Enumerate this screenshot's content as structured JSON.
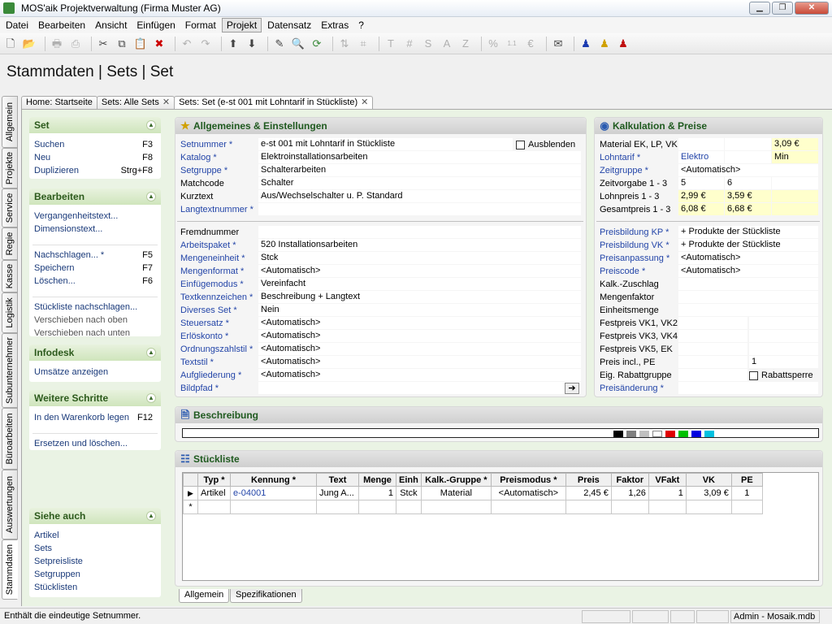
{
  "window": {
    "title": "MOS'aik Projektverwaltung (Firma Muster AG)",
    "accent": "#2c5a1c"
  },
  "menu": [
    "Datei",
    "Bearbeiten",
    "Ansicht",
    "Einfügen",
    "Format",
    "Projekt",
    "Datensatz",
    "Extras",
    "?"
  ],
  "menu_active": "Projekt",
  "page_title": "Stammdaten | Sets | Set",
  "vtabs": [
    "Allgemein",
    "Projekte",
    "Service",
    "Regie",
    "Kasse",
    "Logistik",
    "Subunternehmer",
    "Büroarbeiten",
    "Auswertungen",
    "Stammdaten"
  ],
  "doc_tabs": [
    {
      "label": "Home: Startseite",
      "closable": false
    },
    {
      "label": "Sets: Alle Sets",
      "closable": true
    },
    {
      "label": "Sets: Set (e-st 001 mit Lohntarif in Stückliste)",
      "closable": true
    }
  ],
  "close_glyph": "✕",
  "sidebar": {
    "set": {
      "title": "Set",
      "items": [
        {
          "label": "Suchen",
          "key": "F3"
        },
        {
          "label": "Neu",
          "key": "F8"
        },
        {
          "label": "Duplizieren",
          "key": "Strg+F8"
        }
      ]
    },
    "bearbeiten": {
      "title": "Bearbeiten",
      "items": [
        {
          "label": "Vergangenheitstext...",
          "key": ""
        },
        {
          "label": "Dimensionstext...",
          "key": ""
        },
        {
          "label": "Nachschlagen... *",
          "key": "F5"
        },
        {
          "label": "Speichern",
          "key": "F7"
        },
        {
          "label": "Löschen...",
          "key": "F6"
        },
        {
          "label": "Stückliste nachschlagen...",
          "key": ""
        },
        {
          "label": "Verschieben nach oben",
          "key": ""
        },
        {
          "label": "Verschieben nach unten",
          "key": ""
        }
      ]
    },
    "infodesk": {
      "title": "Infodesk",
      "items": [
        {
          "label": "Umsätze anzeigen",
          "key": ""
        }
      ]
    },
    "weitere": {
      "title": "Weitere Schritte",
      "items": [
        {
          "label": "In den Warenkorb legen",
          "key": "F12"
        },
        {
          "label": "Ersetzen und löschen...",
          "key": ""
        }
      ]
    },
    "siehe": {
      "title": "Siehe auch",
      "items": [
        "Artikel",
        "Sets",
        "Setpreisliste",
        "Setgruppen",
        "Stücklisten"
      ]
    }
  },
  "allgemeines": {
    "title": "Allgemeines & Einstellungen",
    "ausblenden": "Ausblenden",
    "fields1": [
      {
        "label": "Setnummer *",
        "value": "e-st 001 mit Lohntarif in Stückliste",
        "req": true
      },
      {
        "label": "Katalog *",
        "value": "Elektroinstallationsarbeiten",
        "req": true
      },
      {
        "label": "Setgruppe *",
        "value": "Schalterarbeiten",
        "req": true
      },
      {
        "label": "Matchcode",
        "value": "Schalter",
        "req": false
      },
      {
        "label": "Kurztext",
        "value": "Aus/Wechselschalter u. P. Standard",
        "req": false
      },
      {
        "label": "Langtextnummer *",
        "value": "",
        "req": true
      }
    ],
    "fields2": [
      {
        "label": "Fremdnummer",
        "value": "",
        "req": false
      },
      {
        "label": "Arbeitspaket *",
        "value": "520 Installationsarbeiten",
        "req": true
      },
      {
        "label": "Mengeneinheit *",
        "value": "Stck",
        "req": true
      },
      {
        "label": "Mengenformat *",
        "value": "<Automatisch>",
        "req": true
      },
      {
        "label": "Einfügemodus *",
        "value": "Vereinfacht",
        "req": true
      },
      {
        "label": "Textkennzeichen *",
        "value": "Beschreibung + Langtext",
        "req": true
      },
      {
        "label": "Diverses Set *",
        "value": "Nein",
        "req": true
      },
      {
        "label": "Steuersatz *",
        "value": "<Automatisch>",
        "req": true
      },
      {
        "label": "Erlöskonto *",
        "value": "<Automatisch>",
        "req": true
      },
      {
        "label": "Ordnungszahlstil *",
        "value": "<Automatisch>",
        "req": true
      },
      {
        "label": "Textstil *",
        "value": "<Automatisch>",
        "req": true
      },
      {
        "label": "Aufgliederung *",
        "value": "<Automatisch>",
        "req": true
      },
      {
        "label": "Bildpfad *",
        "value": "",
        "req": true
      }
    ]
  },
  "kalkulation": {
    "title": "Kalkulation & Preise",
    "rows1": [
      {
        "label": "Material EK, LP, VK",
        "req": false,
        "v": [
          "",
          "",
          "3,09 €"
        ],
        "y": [
          false,
          false,
          true
        ]
      },
      {
        "label": "Lohntarif *",
        "req": true,
        "v": [
          "Elektro",
          "",
          "Min"
        ],
        "y": [
          false,
          false,
          true
        ],
        "blue": [
          true,
          false,
          false
        ]
      },
      {
        "label": "Zeitgruppe *",
        "req": true,
        "v": [
          "<Automatisch>"
        ],
        "y": [
          false
        ]
      },
      {
        "label": "Zeitvorgabe 1 - 3",
        "req": false,
        "v": [
          "5",
          "6",
          ""
        ],
        "y": [
          false,
          false,
          false
        ]
      },
      {
        "label": "Lohnpreis 1 - 3",
        "req": false,
        "v": [
          "2,99 €",
          "3,59 €",
          ""
        ],
        "y": [
          true,
          true,
          true
        ]
      },
      {
        "label": "Gesamtpreis 1 - 3",
        "req": false,
        "v": [
          "6,08 €",
          "6,68 €",
          ""
        ],
        "y": [
          true,
          true,
          true
        ]
      }
    ],
    "rows2": [
      {
        "label": "Preisbildung KP *",
        "req": true,
        "value": "+ Produkte der Stückliste"
      },
      {
        "label": "Preisbildung VK *",
        "req": true,
        "value": "+ Produkte der Stückliste"
      },
      {
        "label": "Preisanpassung *",
        "req": true,
        "value": "<Automatisch>"
      },
      {
        "label": "Preiscode *",
        "req": true,
        "value": "<Automatisch>"
      },
      {
        "label": "Kalk.-Zuschlag",
        "req": false,
        "value": ""
      },
      {
        "label": "Mengenfaktor",
        "req": false,
        "value": ""
      },
      {
        "label": "Einheitsmenge",
        "req": false,
        "value": ""
      },
      {
        "label": "Festpreis VK1, VK2",
        "req": false,
        "value": ""
      },
      {
        "label": "Festpreis VK3, VK4",
        "req": false,
        "value": ""
      },
      {
        "label": "Festpreis VK5, EK",
        "req": false,
        "value": ""
      },
      {
        "label": "Preis incl., PE",
        "req": false,
        "value": "",
        "value2": "1"
      },
      {
        "label": "Eig. Rabattgruppe",
        "req": false,
        "value": ""
      },
      {
        "label": "Preisänderung *",
        "req": true,
        "value": ""
      }
    ],
    "rabattsperre": "Rabattsperre"
  },
  "beschreibung": {
    "title": "Beschreibung"
  },
  "stueckliste": {
    "title": "Stückliste",
    "columns": [
      "Typ *",
      "Kennung *",
      "Text",
      "Menge",
      "Einh",
      "Kalk.-Gruppe *",
      "Preismodus *",
      "Preis",
      "Faktor",
      "VFakt",
      "VK",
      "PE"
    ],
    "rows": [
      [
        "Artikel",
        "e-04001",
        "Jung A...",
        "1",
        "Stck",
        "Material",
        "<Automatisch>",
        "2,45 €",
        "1,26",
        "1",
        "3,09 €",
        "1"
      ]
    ],
    "new_row_marker": "*",
    "current_row_marker": "▶"
  },
  "bottom_tabs": [
    "Allgemein",
    "Spezifikationen"
  ],
  "status": {
    "text": "Enthält die eindeutige Setnummer.",
    "user": "Admin - Mosaik.mdb"
  }
}
